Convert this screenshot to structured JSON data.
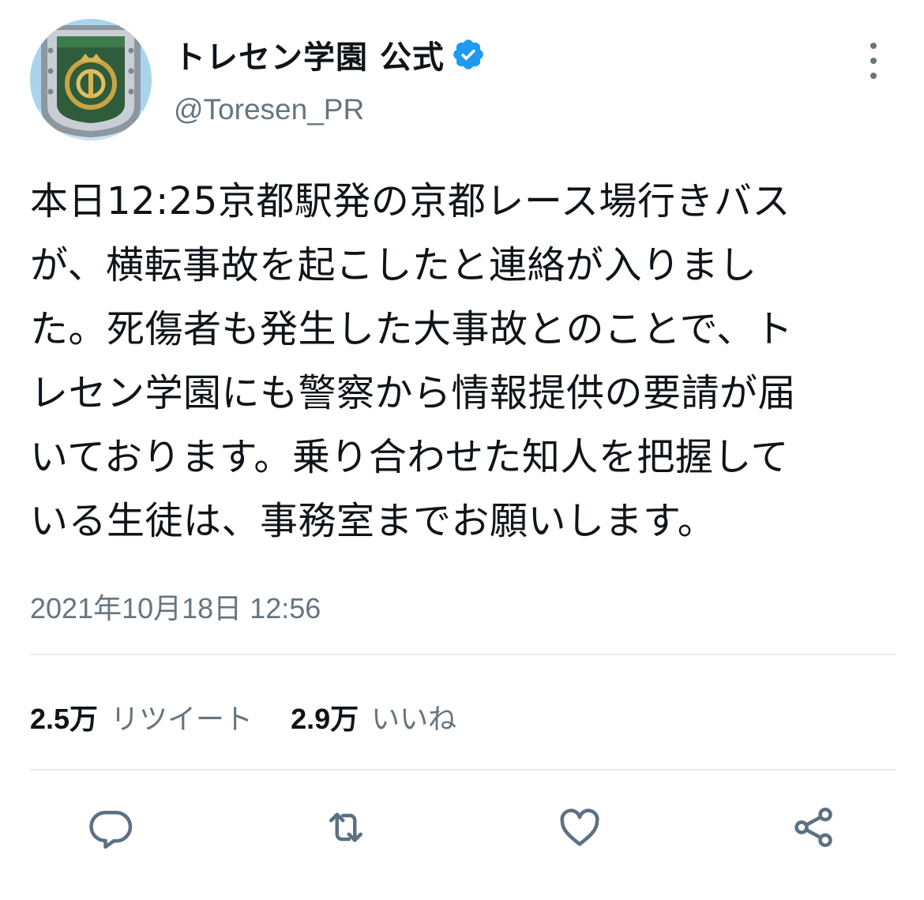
{
  "author": {
    "display_name": "トレセン学園 公式",
    "handle": "@Toresen_PR",
    "verified": true,
    "avatar_icon": "school-crest-avatar",
    "verified_icon": "verified-badge-icon"
  },
  "tweet": {
    "lines": [
      "本日12:25京都駅発の京都レース場行きバス",
      "が、横転事故を起こしたと連絡が入りまし",
      "た。死傷者も発生した大事故とのことで、ト",
      "レセン学園にも警察から情報提供の要請が届",
      "いております。乗り合わせた知人を把握して",
      "いる生徒は、事務室までお願いします。"
    ],
    "timestamp": "2021年10月18日 12:56"
  },
  "stats": {
    "retweet_count": "2.5万",
    "retweet_label": "リツイート",
    "like_count": "2.9万",
    "like_label": "いいね"
  },
  "actions": [
    "reply-icon",
    "retweet-icon",
    "like-icon",
    "share-icon"
  ],
  "colors": {
    "text": "#0f1419",
    "secondary": "#66757f",
    "verified": "#1d9bf0",
    "divider": "#e6ecf0",
    "action_icon": "#5b7083"
  }
}
